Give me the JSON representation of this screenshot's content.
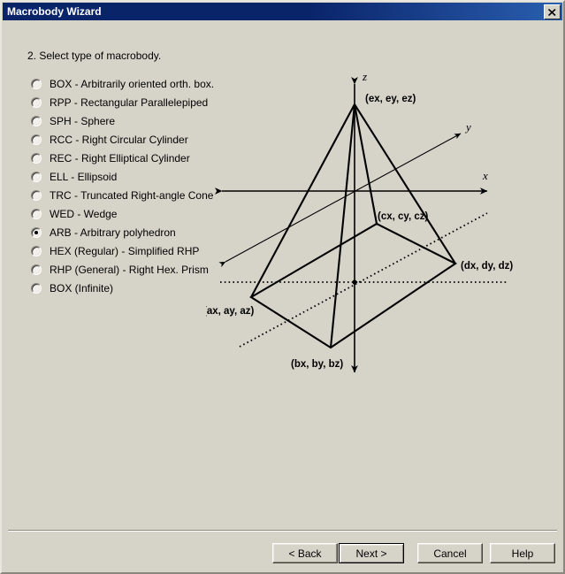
{
  "window": {
    "title": "Macrobody Wizard",
    "close_icon": "close-icon"
  },
  "main": {
    "prompt": "2. Select type of macrobody.",
    "options": [
      {
        "label": "BOX - Arbitrarily oriented orth. box.",
        "selected": false
      },
      {
        "label": "RPP - Rectangular Parallelepiped",
        "selected": false
      },
      {
        "label": "SPH - Sphere",
        "selected": false
      },
      {
        "label": "RCC - Right Circular Cylinder",
        "selected": false
      },
      {
        "label": "REC - Right Elliptical Cylinder",
        "selected": false
      },
      {
        "label": "ELL - Ellipsoid",
        "selected": false
      },
      {
        "label": "TRC - Truncated Right-angle Cone",
        "selected": false
      },
      {
        "label": "WED - Wedge",
        "selected": false
      },
      {
        "label": "ARB - Arbitrary polyhedron",
        "selected": true
      },
      {
        "label": "HEX (Regular) - Simplified RHP",
        "selected": false
      },
      {
        "label": "RHP (General) - Right Hex. Prism",
        "selected": false
      },
      {
        "label": "BOX (Infinite)",
        "selected": false
      }
    ]
  },
  "diagram": {
    "name": "arb-polyhedron-diagram",
    "axis_labels": {
      "z": "z",
      "y": "y",
      "x": "x"
    },
    "vertex_labels": {
      "e": "(ex, ey, ez)",
      "c": "(cx, cy, cz)",
      "d": "(dx, dy, dz)",
      "a": "(ax, ay, az)",
      "b": "(bx, by, bz)"
    }
  },
  "buttons": {
    "back": "< Back",
    "next": "Next >",
    "cancel": "Cancel",
    "help": "Help"
  },
  "colors": {
    "titlebar": "#0a246a",
    "dialog_face": "#d6d3c9",
    "text": "#000000"
  }
}
